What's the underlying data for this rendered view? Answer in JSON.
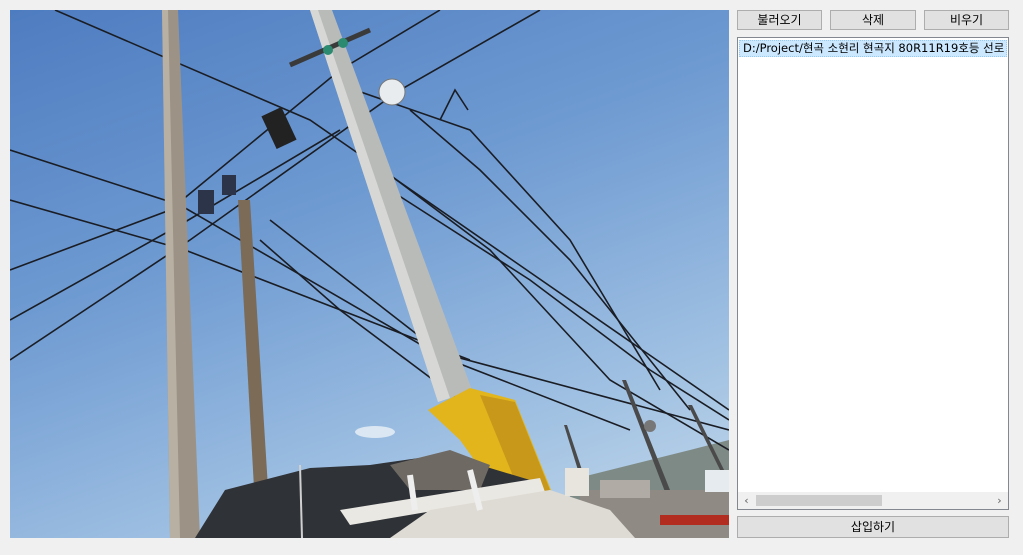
{
  "toolbar": {
    "load_label": "불러오기",
    "delete_label": "삭제",
    "clear_label": "비우기"
  },
  "file_list": {
    "items": [
      "D:/Project/현곡 소현리 현곡지 80R11R19호등 선로"
    ]
  },
  "insert_button": {
    "label": "삽입하기"
  },
  "scrollbar": {
    "left_arrow": "‹",
    "right_arrow": "›"
  },
  "colors": {
    "window_bg": "#f0f0f0",
    "selection": "#cce8ff",
    "sky_top": "#4e7cc0",
    "sky_bottom": "#c3d8ea",
    "crane_yellow": "#e8b820"
  },
  "icons": {
    "scroll_left": "chevron-left-icon",
    "scroll_right": "chevron-right-icon"
  }
}
